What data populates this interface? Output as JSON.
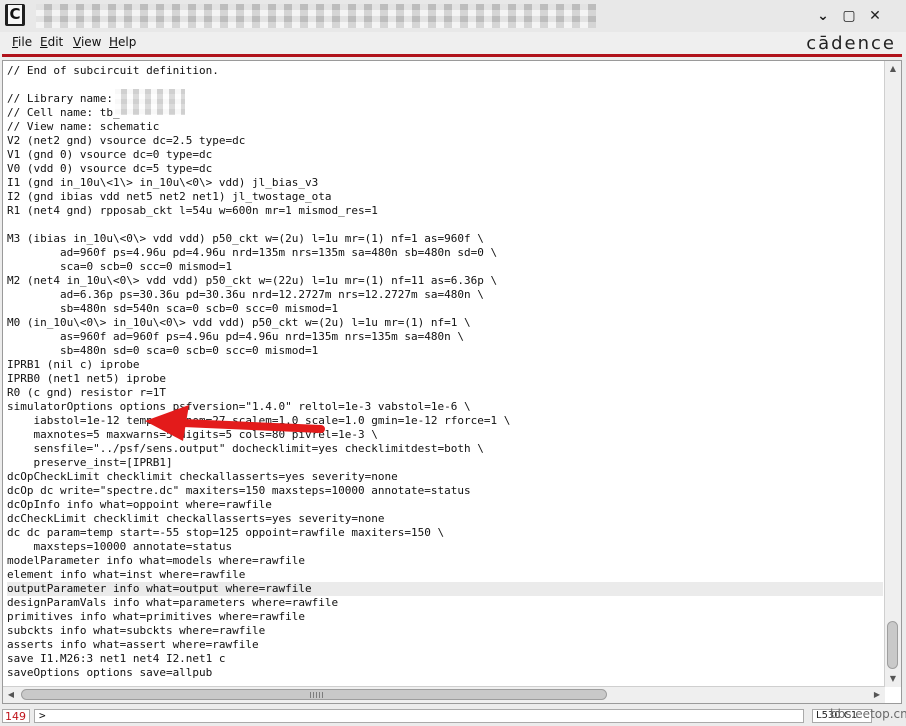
{
  "window": {
    "app_icon_letter": "C",
    "controls": {
      "minimize": "⌄",
      "maximize": "▢",
      "close": "✕"
    }
  },
  "menu": {
    "items": [
      "File",
      "Edit",
      "View",
      "Help"
    ],
    "brand": "cādence"
  },
  "editor": {
    "highlighted_line_index": 37,
    "lines": [
      "// End of subcircuit definition.",
      "",
      "// Library name:",
      "// Cell name: tb_",
      "// View name: schematic",
      "V2 (net2 gnd) vsource dc=2.5 type=dc",
      "V1 (gnd 0) vsource dc=0 type=dc",
      "V0 (vdd 0) vsource dc=5 type=dc",
      "I1 (gnd in_10u\\<1\\> in_10u\\<0\\> vdd) jl_bias_v3",
      "I2 (gnd ibias vdd net5 net2 net1) jl_twostage_ota",
      "R1 (net4 gnd) rpposab_ckt l=54u w=600n mr=1 mismod_res=1",
      "",
      "M3 (ibias in_10u\\<0\\> vdd vdd) p50_ckt w=(2u) l=1u mr=(1) nf=1 as=960f \\",
      "        ad=960f ps=4.96u pd=4.96u nrd=135m nrs=135m sa=480n sb=480n sd=0 \\",
      "        sca=0 scb=0 scc=0 mismod=1",
      "M2 (net4 in_10u\\<0\\> vdd vdd) p50_ckt w=(22u) l=1u mr=(1) nf=11 as=6.36p \\",
      "        ad=6.36p ps=30.36u pd=30.36u nrd=12.2727m nrs=12.2727m sa=480n \\",
      "        sb=480n sd=540n sca=0 scb=0 scc=0 mismod=1",
      "M0 (in_10u\\<0\\> in_10u\\<0\\> vdd vdd) p50_ckt w=(2u) l=1u mr=(1) nf=1 \\",
      "        as=960f ad=960f ps=4.96u pd=4.96u nrd=135m nrs=135m sa=480n \\",
      "        sb=480n sd=0 sca=0 scb=0 scc=0 mismod=1",
      "IPRB1 (nil c) iprobe",
      "IPRB0 (net1 net5) iprobe",
      "R0 (c gnd) resistor r=1T",
      "simulatorOptions options psfversion=\"1.4.0\" reltol=1e-3 vabstol=1e-6 \\",
      "    iabstol=1e-12 temp=25 tnom=27 scalem=1.0 scale=1.0 gmin=1e-12 rforce=1 \\",
      "    maxnotes=5 maxwarns=5 digits=5 cols=80 pivrel=1e-3 \\",
      "    sensfile=\"../psf/sens.output\" dochecklimit=yes checklimitdest=both \\",
      "    preserve_inst=[IPRB1]",
      "dcOpCheckLimit checklimit checkallasserts=yes severity=none",
      "dcOp dc write=\"spectre.dc\" maxiters=150 maxsteps=10000 annotate=status",
      "dcOpInfo info what=oppoint where=rawfile",
      "dcCheckLimit checklimit checkallasserts=yes severity=none",
      "dc dc param=temp start=-55 stop=125 oppoint=rawfile maxiters=150 \\",
      "    maxsteps=10000 annotate=status",
      "modelParameter info what=models where=rawfile",
      "element info what=inst where=rawfile",
      "outputParameter info what=output where=rawfile",
      "designParamVals info what=parameters where=rawfile",
      "primitives info what=primitives where=rawfile",
      "subckts info what=subckts where=rawfile",
      "asserts info what=assert where=rawfile",
      "save I1.M26:3 net1 net4 I2.net1 c",
      "saveOptions options save=allpub"
    ]
  },
  "annotation": {
    "color": "#e31b1b"
  },
  "status": {
    "line_count": "149",
    "prompt": ">",
    "position": "L530  C1",
    "watermark": "bbs.eetop.cn"
  }
}
